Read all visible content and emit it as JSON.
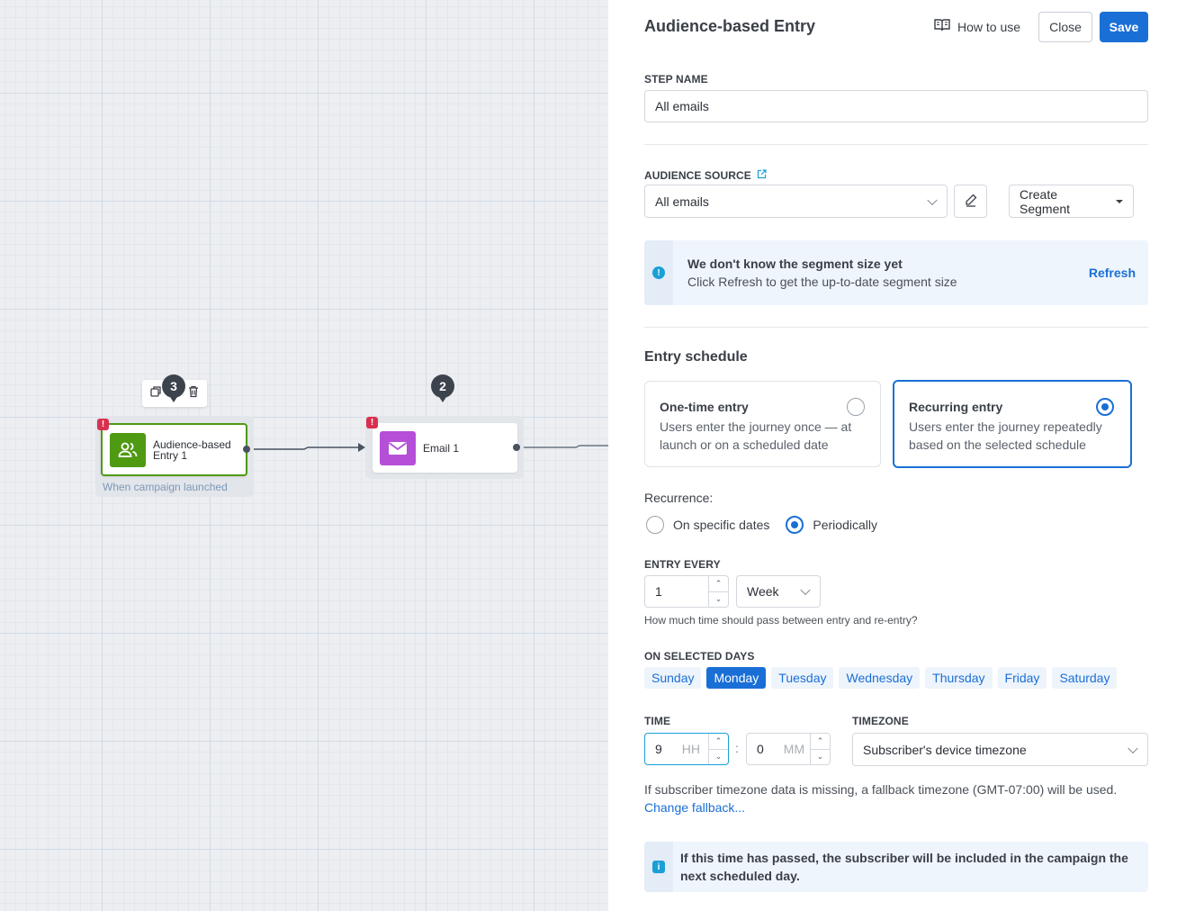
{
  "canvas": {
    "entry_node": {
      "label": "Audience-based Entry 1",
      "caption": "When campaign launched",
      "count": "3",
      "warning": "!",
      "icon_color": "#4f9a13"
    },
    "email_node": {
      "label": "Email 1",
      "count": "2",
      "warning": "!",
      "icon_color": "#b54fd8"
    }
  },
  "panel": {
    "title": "Audience-based Entry",
    "how_to_use": "How to use",
    "close": "Close",
    "save": "Save",
    "step_name": {
      "label": "STEP NAME",
      "value": "All emails"
    },
    "audience_source": {
      "label": "AUDIENCE SOURCE",
      "value": "All emails",
      "create_segment": "Create Segment"
    },
    "segment_info": {
      "title": "We don't know the segment size yet",
      "body": "Click Refresh to get the up-to-date segment size",
      "action": "Refresh"
    },
    "entry_schedule": {
      "heading": "Entry schedule",
      "one_time": {
        "title": "One-time entry",
        "desc": "Users enter the journey once — at launch or on a scheduled date"
      },
      "recurring": {
        "title": "Recurring entry",
        "desc": "Users enter the journey repeatedly based on the selected schedule"
      }
    },
    "recurrence": {
      "label": "Recurrence:",
      "specific": "On specific dates",
      "periodically": "Periodically"
    },
    "entry_every": {
      "label": "ENTRY EVERY",
      "value": "1",
      "unit": "Week",
      "hint": "How much time should pass between entry and re-entry?"
    },
    "days": {
      "label": "ON SELECTED DAYS",
      "items": [
        "Sunday",
        "Monday",
        "Tuesday",
        "Wednesday",
        "Thursday",
        "Friday",
        "Saturday"
      ],
      "selected": "Monday"
    },
    "time": {
      "label": "TIME",
      "hours": "9",
      "hours_placeholder": "HH",
      "separator": ":",
      "minutes": "0",
      "minutes_placeholder": "MM"
    },
    "timezone": {
      "label": "TIMEZONE",
      "value": "Subscriber's device timezone",
      "note": "If subscriber timezone data is missing, a fallback timezone (GMT-07:00) will be used.",
      "change_link": "Change fallback..."
    },
    "time_info": {
      "text": "If this time has passed, the subscriber will be included in the campaign the next scheduled day."
    },
    "accent": "#1a6fd6"
  }
}
